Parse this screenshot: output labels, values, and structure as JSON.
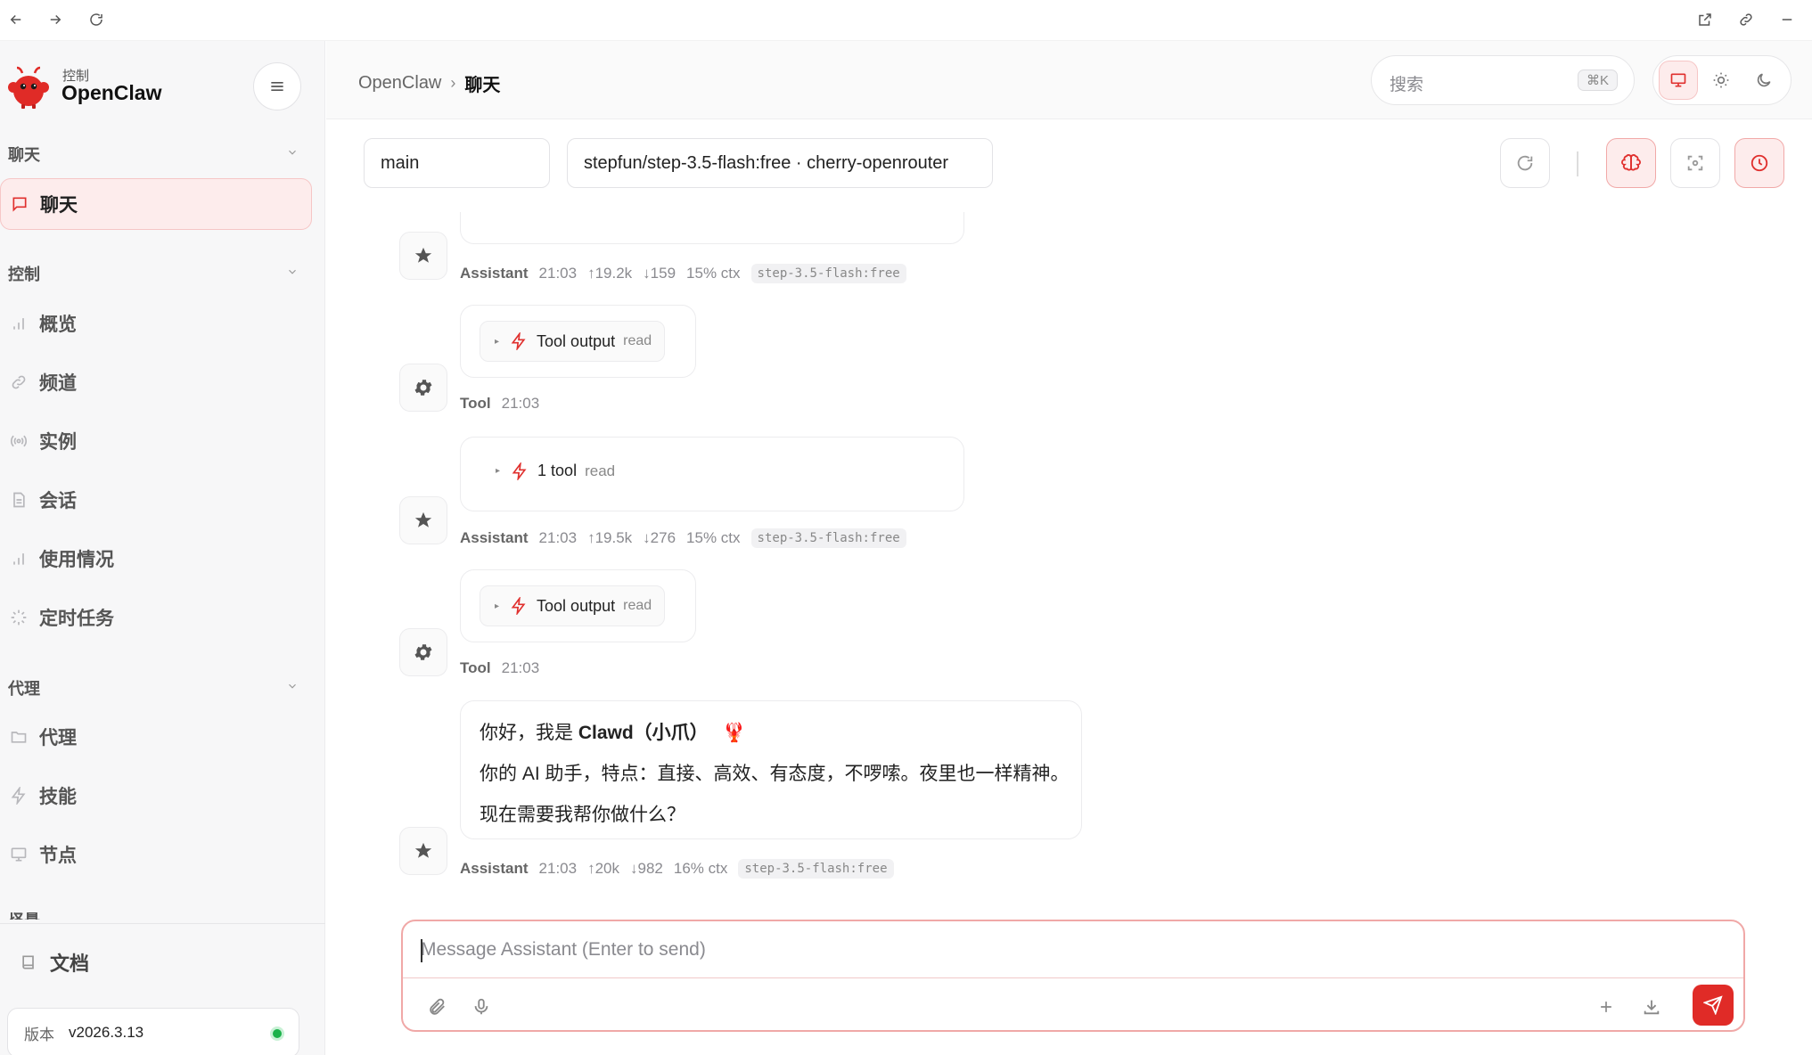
{
  "sidebar": {
    "brand_small": "控制",
    "brand_name": "OpenClaw",
    "sections": {
      "chat": "聊天",
      "control": "控制",
      "agent": "代理",
      "settings_partial": "设置"
    },
    "items": {
      "chat": "聊天",
      "overview": "概览",
      "channels": "频道",
      "instances": "实例",
      "sessions": "会话",
      "usage": "使用情况",
      "cron": "定时任务",
      "agents": "代理",
      "skills": "技能",
      "nodes": "节点"
    },
    "docs": "文档",
    "version_label": "版本",
    "version_value": "v2026.3.13",
    "status_color": "#1bb24a"
  },
  "header": {
    "crumb_root": "OpenClaw",
    "crumb_sep": "›",
    "crumb_current": "聊天",
    "search_placeholder": "搜索",
    "search_shortcut": "⌘K"
  },
  "toolbar": {
    "session": "main",
    "model": "stepfun/step-3.5-flash:free · cherry-openrouter"
  },
  "messages": {
    "m1": {
      "who": "Assistant",
      "time": "21:03",
      "up": "↑19.2k",
      "down": "↓159",
      "ctx": "15% ctx",
      "model": "step-3.5-flash:free"
    },
    "m2": {
      "chip_label": "Tool output",
      "chip_tag": "read",
      "who": "Tool",
      "time": "21:03"
    },
    "m3": {
      "row_label": "1 tool",
      "row_tag": "read",
      "who": "Assistant",
      "time": "21:03",
      "up": "↑19.5k",
      "down": "↓276",
      "ctx": "15% ctx",
      "model": "step-3.5-flash:free"
    },
    "m4": {
      "chip_label": "Tool output",
      "chip_tag": "read",
      "who": "Tool",
      "time": "21:03"
    },
    "m5": {
      "line1_pre": "你好，我是 ",
      "line1_bold": "Clawd（小爪）",
      "line1_emoji": "🦞",
      "line2": "你的 AI 助手，特点：直接、高效、有态度，不啰嗦。夜里也一样精神。",
      "line3": "现在需要我帮你做什么？",
      "who": "Assistant",
      "time": "21:03",
      "up": "↑20k",
      "down": "↓982",
      "ctx": "16% ctx",
      "model": "step-3.5-flash:free"
    }
  },
  "composer": {
    "placeholder": "Message Assistant (Enter to send)"
  },
  "colors": {
    "accent": "#e0302e",
    "accent_soft": "#fdecec"
  }
}
